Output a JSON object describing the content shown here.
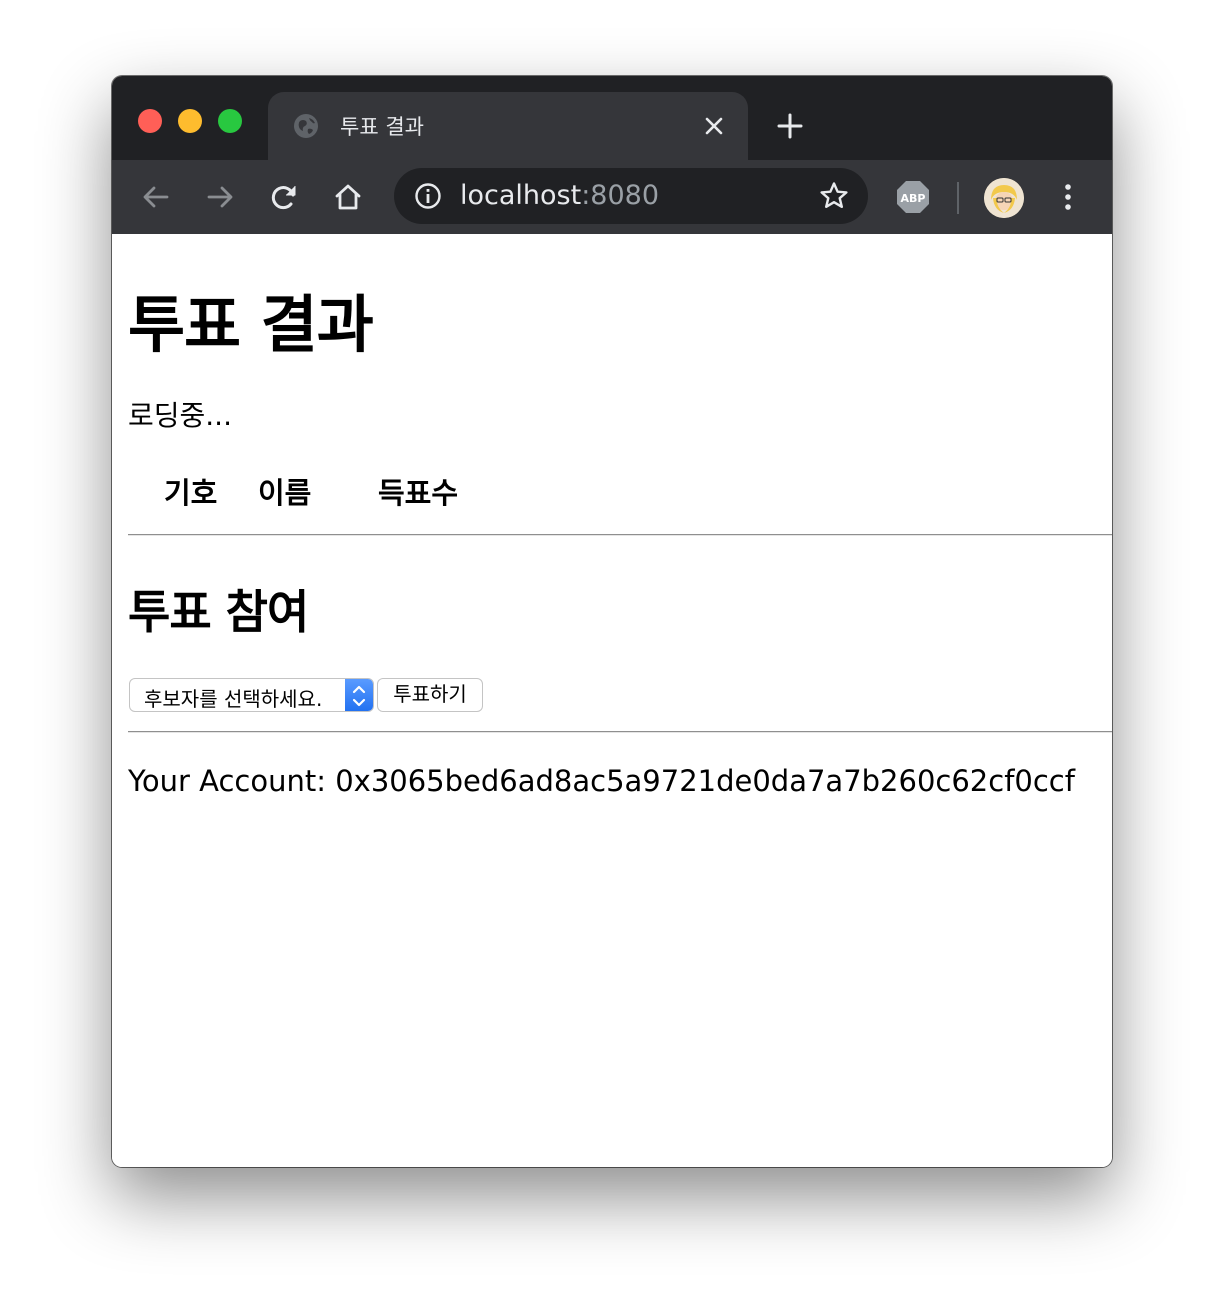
{
  "browser": {
    "tab": {
      "title": "투표 결과",
      "favicon": "globe-icon"
    },
    "omnibox": {
      "host": "localhost",
      "port": ":8080"
    },
    "extensions": {
      "abp_label": "ABP"
    },
    "colors": {
      "tabstrip": "#202124",
      "toolbar": "#35363a",
      "omnibox": "#202124"
    }
  },
  "page": {
    "results_heading": "투표 결과",
    "loading_text": "로딩중...",
    "table_headers": [
      "기호",
      "이름",
      "득표수"
    ],
    "vote_heading": "투표 참여",
    "candidate_select": {
      "selected": "후보자를 선택하세요."
    },
    "vote_button_label": "투표하기",
    "account_text": "Your Account: 0x3065bed6ad8ac5a9721de0da7a7b260c62cf0ccf"
  }
}
